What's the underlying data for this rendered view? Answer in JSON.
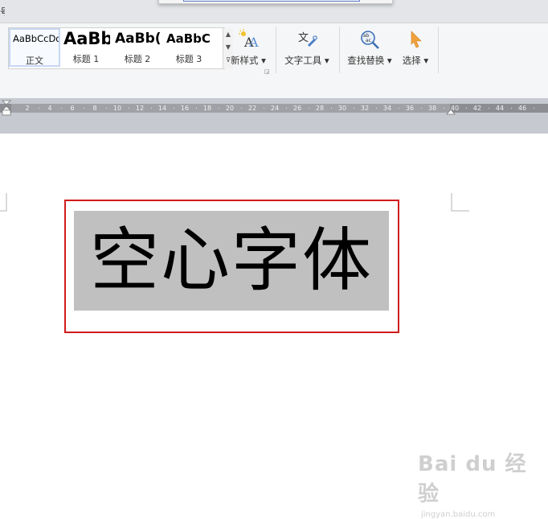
{
  "top": {
    "cut_char": "号"
  },
  "styles": [
    {
      "sample": "AaBbCcDd",
      "label": "正文",
      "selected": true
    },
    {
      "sample": "AaBb",
      "label": "标题 1"
    },
    {
      "sample": "AaBb(",
      "label": "标题 2"
    },
    {
      "sample": "AaBbC",
      "label": "标题 3"
    }
  ],
  "buttons": {
    "new_style": "新样式",
    "text_tools": "文字工具",
    "find_replace": "查找替换",
    "select": "选择"
  },
  "ruler": {
    "ticks": [
      "2",
      "4",
      "6",
      "8",
      "10",
      "12",
      "14",
      "16",
      "18",
      "20",
      "22",
      "24",
      "26",
      "28",
      "30",
      "32",
      "34",
      "36",
      "38",
      "40",
      "42",
      "44",
      "46"
    ]
  },
  "document": {
    "text": "空心字体"
  },
  "watermark": {
    "logo": "Bai du 经验",
    "url": "jingyan.baidu.com"
  },
  "colors": {
    "highlight_box": "#d01b1b",
    "text_shading": "#c0c0c0"
  }
}
